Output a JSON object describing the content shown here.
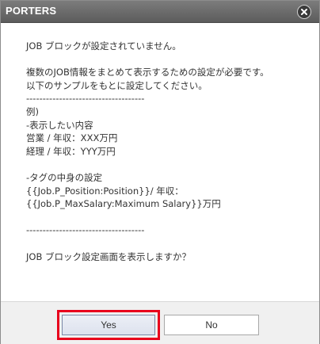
{
  "dialog": {
    "title": "PORTERS",
    "close_icon": "close-icon",
    "message_lines": [
      "JOB ブロックが設定されていません。",
      "",
      "複数のJOB情報をまとめて表示するための設定が必要です。",
      "以下のサンプルをもとに設定してください。",
      "------------------------------------",
      "例)",
      "-表示したい内容",
      "営業 / 年収：XXX万円",
      "経理 / 年収：YYY万円",
      "",
      "-タグの中身の設定",
      "{{Job.P_Position:Position}}/ 年収：",
      "{{Job.P_MaxSalary:Maximum Salary}}万円",
      "",
      "------------------------------------",
      "",
      "JOB ブロック設定画面を表示しますか？"
    ],
    "buttons": {
      "yes_label": "Yes",
      "no_label": "No"
    },
    "colors": {
      "titlebar": "#6b6b6b",
      "highlight": "#e8001c",
      "footer": "#f0f0f0"
    }
  }
}
